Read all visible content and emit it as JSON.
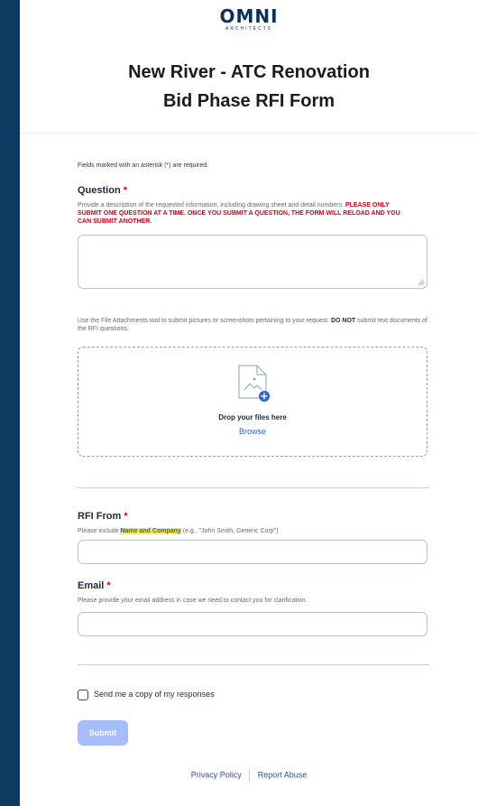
{
  "logo": {
    "main": "OMNI",
    "sub": "ARCHITECTS"
  },
  "form": {
    "title_line1": "New River - ATC Renovation",
    "title_line2": "Bid Phase RFI Form",
    "required_note": "Fields marked with an asterisk (*) are required."
  },
  "question": {
    "label": "Question",
    "asterisk": "*",
    "help_plain": "Provide a description of the requested information, including drawing sheet and detail numbers.",
    "help_warning": "PLEASE ONLY SUBMIT ONE QUESTION AT A TIME. ONCE YOU SUBMIT A QUESTION, THE FORM WILL RELOAD AND YOU CAN SUBMIT ANOTHER.",
    "value": ""
  },
  "attachments": {
    "help_before": "Use the File Attachments tool to submit pictures or screenshots pertaining to your request.",
    "help_bold": "DO NOT",
    "help_after": "submit text documents of the RFI questions.",
    "drop_text": "Drop your files here",
    "browse_label": "Browse"
  },
  "rfi_from": {
    "label": "RFI From",
    "asterisk": "*",
    "help_before": "Please include",
    "help_highlight": "Name and Company",
    "help_after": "(e.g., \"John Smith, Generic Corp\")",
    "value": ""
  },
  "email": {
    "label": "Email",
    "asterisk": "*",
    "help": "Please provide your email address in case we need to contact you for clarification.",
    "value": ""
  },
  "copy_checkbox": {
    "label": "Send me a copy of my responses",
    "checked": false
  },
  "submit": {
    "label": "Submit"
  },
  "footer": {
    "privacy": "Privacy Policy",
    "abuse": "Report Abuse"
  },
  "colors": {
    "page_bg": "#0b3a63",
    "accent": "#2c63d6",
    "required": "#d0021b",
    "submit_disabled": "#a6bdfb"
  }
}
